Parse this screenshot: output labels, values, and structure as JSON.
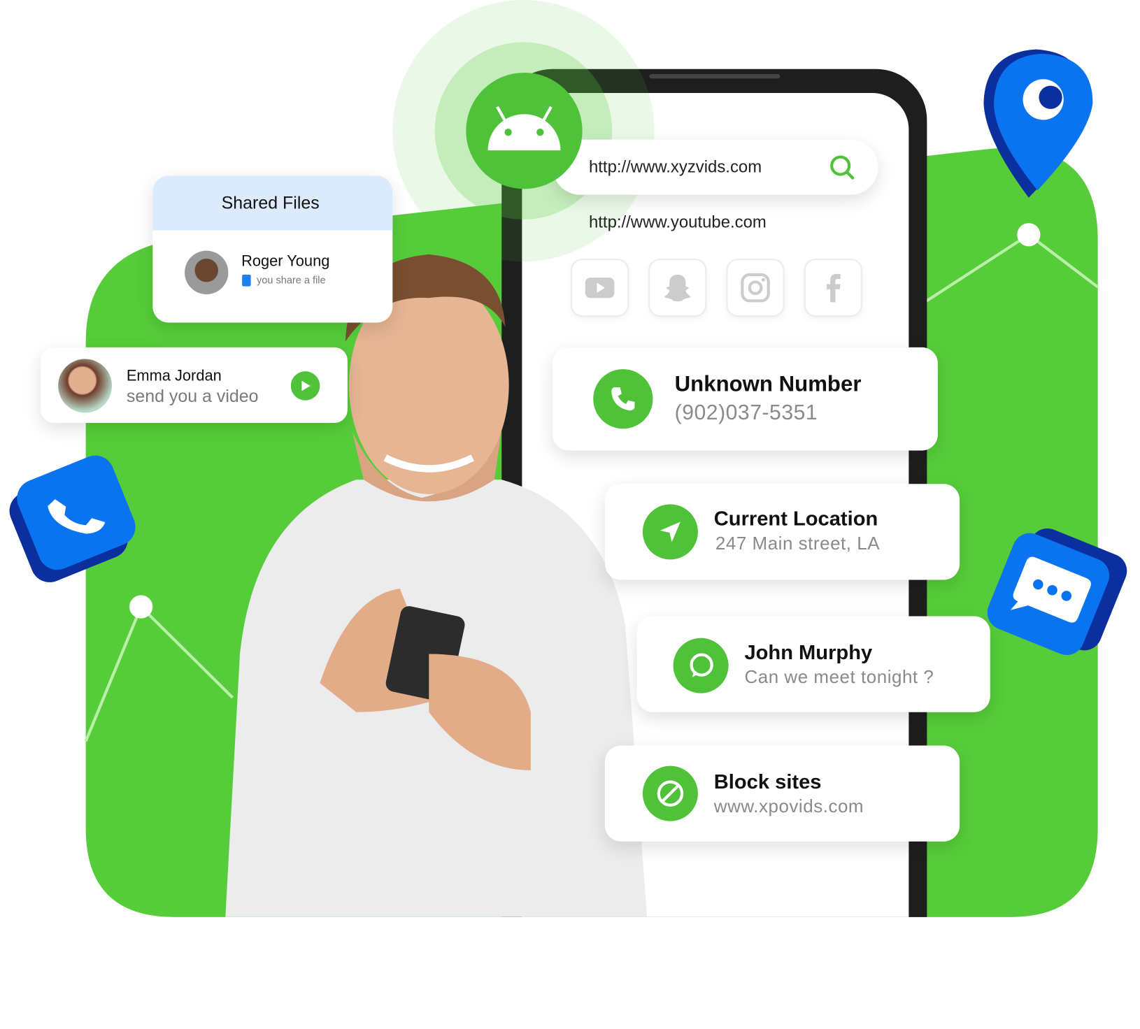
{
  "colors": {
    "green": "#56cc3a",
    "blue": "#0a74f0",
    "dark_blue": "#0b2f9c"
  },
  "browser": {
    "url_input": "http://www.xyzvids.com",
    "suggestion": "http://www.youtube.com",
    "search_icon": "search-icon"
  },
  "social_icons": [
    "youtube-icon",
    "snapchat-icon",
    "instagram-icon",
    "facebook-icon"
  ],
  "shared_files": {
    "title": "Shared Files",
    "name": "Roger Young",
    "subtitle": "you share a file"
  },
  "video_card": {
    "name": "Emma Jordan",
    "subtitle": "send you a video"
  },
  "cards": [
    {
      "title": "Unknown Number",
      "subtitle": "(902)037-5351",
      "icon": "phone-icon"
    },
    {
      "title": "Current Location",
      "subtitle": "247 Main street, LA",
      "icon": "navigation-icon"
    },
    {
      "title": "John Murphy",
      "subtitle": "Can we meet tonight ?",
      "icon": "chat-icon"
    },
    {
      "title": "Block sites",
      "subtitle": "www.xpovids.com",
      "icon": "block-icon"
    }
  ]
}
